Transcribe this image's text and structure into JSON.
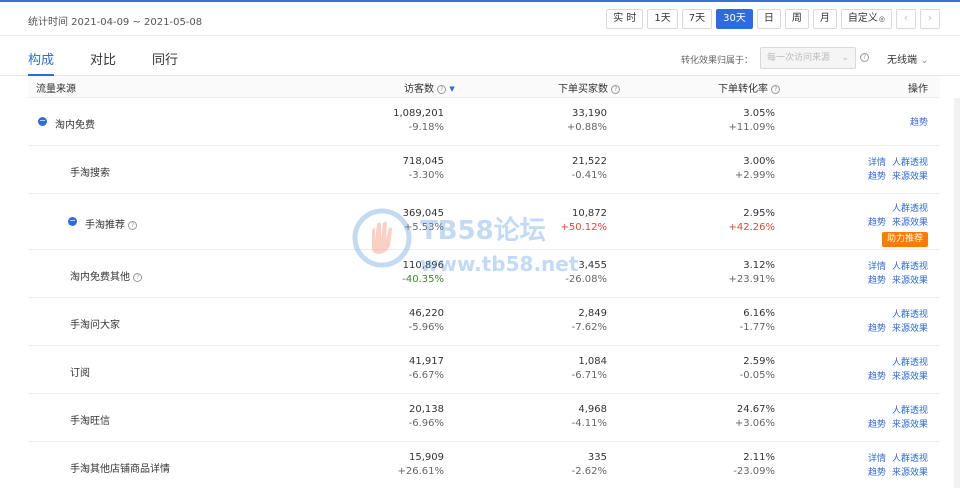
{
  "date_range": "统计时间 2021-04-09 ~ 2021-05-08",
  "periods": [
    "实 时",
    "1天",
    "7天",
    "30天",
    "日",
    "周",
    "月",
    "自定义"
  ],
  "active_period": "30天",
  "custom_chev": "◎",
  "nav_prev": "‹",
  "nav_next": "›",
  "tabs": [
    "构成",
    "对比",
    "同行"
  ],
  "attribution": {
    "label": "转化效果归属于：",
    "placeholder": "每一次访问来源",
    "help": "?",
    "dedup": "无线端"
  },
  "table": {
    "headers": {
      "source": "流量来源",
      "visitors": "访客数",
      "buyers": "下单买家数",
      "rate": "下单转化率",
      "ops": "操作"
    },
    "rows": [
      {
        "source": "淘内免费",
        "expand": "−",
        "visitors": "1,089,201",
        "visitors_chg": "-9.18%",
        "buyers": "33,190",
        "buyers_chg": "+0.88%",
        "rate": "3.05%",
        "rate_chg": "+11.09%",
        "ops_line1": [
          "趋势"
        ],
        "ops_line2": []
      },
      {
        "source": "手淘搜索",
        "visitors": "718,045",
        "visitors_chg": "-3.30%",
        "buyers": "21,522",
        "buyers_chg": "-0.41%",
        "rate": "3.00%",
        "rate_chg": "+2.99%",
        "ops_line1": [
          "详情",
          "人群透视"
        ],
        "ops_line2": [
          "趋势",
          "来源效果"
        ]
      },
      {
        "source": "手淘推荐",
        "expand": "−",
        "help": "?",
        "visitors": "369,045",
        "visitors_chg": "+5.53%",
        "buyers": "10,872",
        "buyers_chg": "+50.12%",
        "rate": "2.95%",
        "rate_chg": "+42.26%",
        "ops_line1": [
          "人群透视"
        ],
        "ops_line2": [
          "趋势",
          "来源效果"
        ],
        "badge": "助力推荐"
      },
      {
        "source": "淘内免费其他",
        "help": "?",
        "visitors": "110,896",
        "visitors_chg": "-40.35%",
        "buyers": "3,455",
        "buyers_chg": "-26.08%",
        "rate": "3.12%",
        "rate_chg": "+23.91%",
        "ops_line1": [
          "详情",
          "人群透视"
        ],
        "ops_line2": [
          "趋势",
          "来源效果"
        ]
      },
      {
        "source": "手淘问大家",
        "visitors": "46,220",
        "visitors_chg": "-5.96%",
        "buyers": "2,849",
        "buyers_chg": "-7.62%",
        "rate": "6.16%",
        "rate_chg": "-1.77%",
        "ops_line1": [
          "人群透视"
        ],
        "ops_line2": [
          "趋势",
          "来源效果"
        ]
      },
      {
        "source": "订阅",
        "visitors": "41,917",
        "visitors_chg": "-6.67%",
        "buyers": "1,084",
        "buyers_chg": "-6.71%",
        "rate": "2.59%",
        "rate_chg": "-0.05%",
        "ops_line1": [
          "人群透视"
        ],
        "ops_line2": [
          "趋势",
          "来源效果"
        ]
      },
      {
        "source": "手淘旺信",
        "visitors": "20,138",
        "visitors_chg": "-6.96%",
        "buyers": "4,968",
        "buyers_chg": "-4.11%",
        "rate": "24.67%",
        "rate_chg": "+3.06%",
        "ops_line1": [
          "人群透视"
        ],
        "ops_line2": [
          "趋势",
          "来源效果"
        ]
      },
      {
        "source": "手淘其他店铺商品详情",
        "visitors": "15,909",
        "visitors_chg": "+26.61%",
        "buyers": "335",
        "buyers_chg": "-2.62%",
        "rate": "2.11%",
        "rate_chg": "-23.09%",
        "ops_line1": [
          "详情",
          "人群透视"
        ],
        "ops_line2": [
          "趋势",
          "来源效果"
        ]
      }
    ]
  },
  "watermark": {
    "text1": "TB58论坛",
    "text2": "www.tb58.net"
  },
  "colors": {
    "accent": "#2f6ae0",
    "badge": "#ff7a00",
    "up": "#f04134",
    "down": "#3a8a2c"
  }
}
